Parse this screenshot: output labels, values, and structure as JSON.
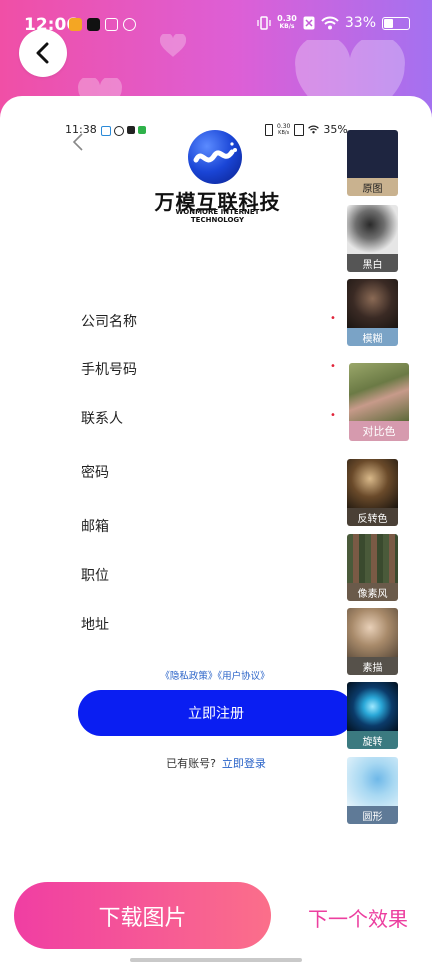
{
  "status_bar": {
    "time": "12:06",
    "net_speed_top": "0.30",
    "net_speed_unit": "KB/s",
    "battery": "33%",
    "battery_level": 0.33
  },
  "inner_status": {
    "time": "11:38",
    "net_speed_top": "0.30",
    "net_speed_unit": "KB/s",
    "battery": "35%"
  },
  "logo": {
    "name_cn": "万模互联科技",
    "name_en": "WONMORE INTERNET TECHNOLOGY"
  },
  "form": {
    "fields": [
      {
        "label": "公司名称",
        "required": true
      },
      {
        "label": "手机号码",
        "required": true
      },
      {
        "label": "联系人",
        "required": true
      },
      {
        "label": "密码",
        "required": false
      },
      {
        "label": "邮箱",
        "required": false
      },
      {
        "label": "职位",
        "required": false
      },
      {
        "label": "地址",
        "required": false
      }
    ],
    "required_mark": "•",
    "policy_text": "《隐私政策》《用户协议》",
    "register_label": "立即注册",
    "have_account_text": "已有账号?",
    "login_link": "立即登录"
  },
  "effects": [
    {
      "label": "原图",
      "caption_color": "#c9b28f"
    },
    {
      "label": "黑白",
      "caption_color": "#555555"
    },
    {
      "label": "模糊",
      "caption_color": "#7aa3c6"
    },
    {
      "label": "对比色",
      "caption_color": "#d69aae"
    },
    {
      "label": "反转色",
      "caption_color": "#4a4036"
    },
    {
      "label": "像素风",
      "caption_color": "#6a5a4a"
    },
    {
      "label": "素描",
      "caption_color": "#56514a"
    },
    {
      "label": "旋转",
      "caption_color": "#3b7a80"
    },
    {
      "label": "圆形",
      "caption_color": "#5f7a97"
    }
  ],
  "actions": {
    "download_label": "下载图片",
    "next_label": "下一个效果"
  },
  "colors": {
    "header_gradient_start": "#f04fa6",
    "header_gradient_end": "#a471f0",
    "primary_blue": "#0a1ef2",
    "accent_pink": "#ec3f9f"
  }
}
